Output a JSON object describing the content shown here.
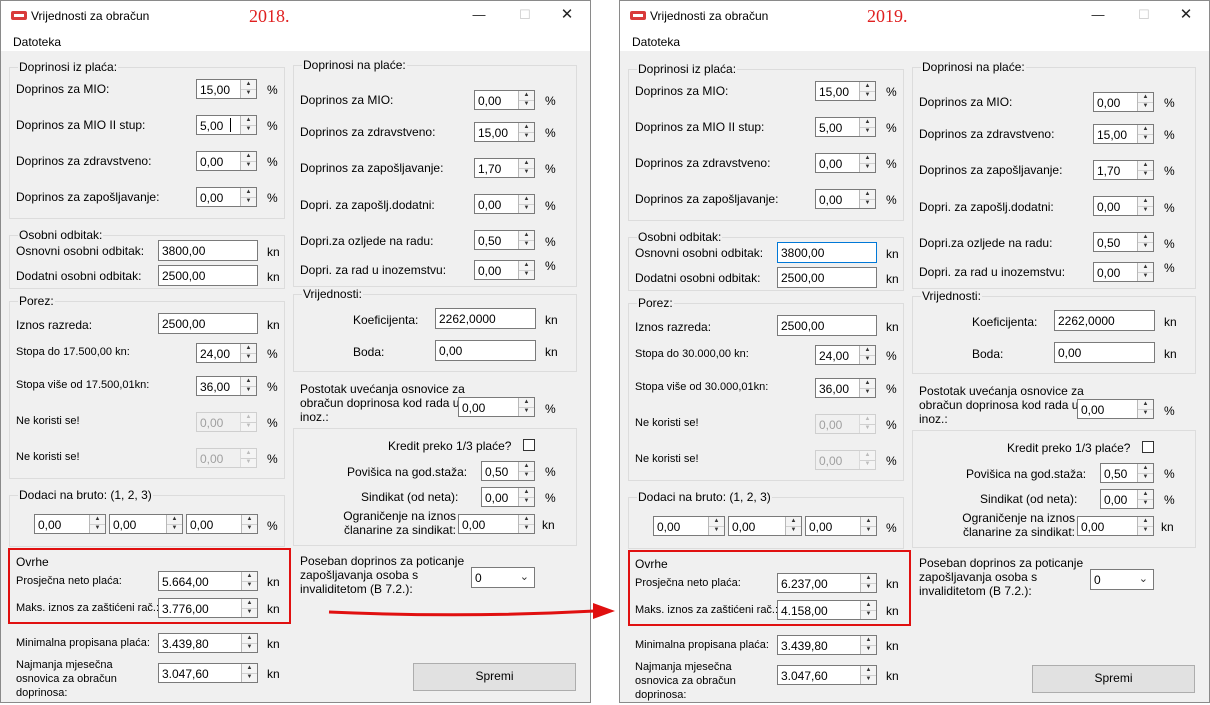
{
  "colors": {
    "annotation": "#e01010",
    "year": "#e02020",
    "focus_border": "#0078d7"
  },
  "windows": [
    {
      "id": "2018",
      "title": "Vrijednosti za obračun",
      "year_label": "2018.",
      "menu": {
        "file": "Datoteka"
      },
      "contrib_from": {
        "title": "Doprinosi iz plaća:",
        "mio_label": "Doprinos za MIO:",
        "mio": "15,00",
        "mio2_label": "Doprinos za MIO II stup:",
        "mio2": "5,00",
        "health_label": "Doprinos za zdravstveno:",
        "health": "0,00",
        "employ_label": "Doprinos za zapošljavanje:",
        "employ": "0,00"
      },
      "personal": {
        "title": "Osobni odbitak:",
        "basic_label": "Osnovni osobni odbitak:",
        "basic": "3800,00",
        "extra_label": "Dodatni osobni odbitak:",
        "extra": "2500,00"
      },
      "tax": {
        "title": "Porez:",
        "bracket_label": "Iznos razreda:",
        "bracket": "2500,00",
        "rate_low_label": "Stopa do 17.500,00 kn:",
        "rate_low": "24,00",
        "rate_high_label": "Stopa više od 17.500,01kn:",
        "rate_high": "36,00",
        "unused1_label": "Ne koristi se!",
        "unused1": "0,00",
        "unused2_label": "Ne koristi se!",
        "unused2": "0,00"
      },
      "gross": {
        "title": "Dodaci na bruto: (1, 2, 3)",
        "v1": "0,00",
        "v2": "0,00",
        "v3": "0,00"
      },
      "garnish": {
        "title": "Ovrhe",
        "avg_label": "Prosječna neto plaća:",
        "avg": "5.664,00",
        "max_label": "Maks. iznos za zaštićeni rač.:",
        "max": "3.776,00"
      },
      "min_wage": {
        "label": "Minimalna propisana plaća:",
        "value": "3.439,80"
      },
      "min_base": {
        "label": "Najmanja mjesečna osnovica za obračun doprinosa:",
        "value": "3.047,60"
      },
      "contrib_on": {
        "title": "Doprinosi na plaće:",
        "mio_label": "Doprinos za MIO:",
        "mio": "0,00",
        "health_label": "Doprinos za zdravstveno:",
        "health": "15,00",
        "employ_label": "Doprinos za zapošljavanje:",
        "employ": "1,70",
        "employ_extra_label": "Dopri. za zapošlj.dodatni:",
        "employ_extra": "0,00",
        "injury_label": "Dopri.za ozljede na radu:",
        "injury": "0,50",
        "abroad_label": "Dopri. za rad u inozemstvu:",
        "abroad": "0,00"
      },
      "values": {
        "title": "Vrijednosti:",
        "coef_label": "Koeficijenta:",
        "coef": "2262,0000",
        "points_label": "Boda:",
        "points": "0,00"
      },
      "increase": {
        "label": "Postotak uvećanja osnovice za obračun doprinosa kod rada u inoz.:",
        "value": "0,00"
      },
      "credit": {
        "label": "Kredit preko 1/3 plaće?",
        "raise_label": "Povišica na god.staža:",
        "raise": "0,50",
        "union_label": "Sindikat (od neta):",
        "union": "0,00",
        "limit_label": "Ograničenje na iznos članarine za sindikat:",
        "limit": "0,00"
      },
      "special": {
        "label": "Poseban doprinos za poticanje zapošljavanja osoba s invaliditetom (B 7.2.):",
        "value": "0"
      },
      "units": {
        "pct": "%",
        "kn": "kn"
      },
      "save_label": "Spremi"
    },
    {
      "id": "2019",
      "title": "Vrijednosti za obračun",
      "year_label": "2019.",
      "menu": {
        "file": "Datoteka"
      },
      "contrib_from": {
        "title": "Doprinosi iz plaća:",
        "mio_label": "Doprinos za MIO:",
        "mio": "15,00",
        "mio2_label": "Doprinos za MIO II stup:",
        "mio2": "5,00",
        "health_label": "Doprinos za zdravstveno:",
        "health": "0,00",
        "employ_label": "Doprinos za zapošljavanje:",
        "employ": "0,00"
      },
      "personal": {
        "title": "Osobni odbitak:",
        "basic_label": "Osnovni osobni odbitak:",
        "basic": "3800,00",
        "extra_label": "Dodatni osobni odbitak:",
        "extra": "2500,00"
      },
      "tax": {
        "title": "Porez:",
        "bracket_label": "Iznos razreda:",
        "bracket": "2500,00",
        "rate_low_label": "Stopa do 30.000,00 kn:",
        "rate_low": "24,00",
        "rate_high_label": "Stopa više od 30.000,01kn:",
        "rate_high": "36,00",
        "unused1_label": "Ne koristi se!",
        "unused1": "0,00",
        "unused2_label": "Ne koristi se!",
        "unused2": "0,00"
      },
      "gross": {
        "title": "Dodaci na bruto: (1, 2, 3)",
        "v1": "0,00",
        "v2": "0,00",
        "v3": "0,00"
      },
      "garnish": {
        "title": "Ovrhe",
        "avg_label": "Prosječna neto plaća:",
        "avg": "6.237,00",
        "max_label": "Maks. iznos za zaštićeni rač.:",
        "max": "4.158,00"
      },
      "min_wage": {
        "label": "Minimalna propisana plaća:",
        "value": "3.439,80"
      },
      "min_base": {
        "label": "Najmanja mjesečna osnovica za obračun doprinosa:",
        "value": "3.047,60"
      },
      "contrib_on": {
        "title": "Doprinosi na plaće:",
        "mio_label": "Doprinos za MIO:",
        "mio": "0,00",
        "health_label": "Doprinos za zdravstveno:",
        "health": "15,00",
        "employ_label": "Doprinos za zapošljavanje:",
        "employ": "1,70",
        "employ_extra_label": "Dopri. za zapošlj.dodatni:",
        "employ_extra": "0,00",
        "injury_label": "Dopri.za ozljede na radu:",
        "injury": "0,50",
        "abroad_label": "Dopri. za rad u inozemstvu:",
        "abroad": "0,00"
      },
      "values": {
        "title": "Vrijednosti:",
        "coef_label": "Koeficijenta:",
        "coef": "2262,0000",
        "points_label": "Boda:",
        "points": "0,00"
      },
      "increase": {
        "label": "Postotak uvećanja osnovice za obračun doprinosa kod rada u inoz.:",
        "value": "0,00"
      },
      "credit": {
        "label": "Kredit preko 1/3 plaće?",
        "raise_label": "Povišica na god.staža:",
        "raise": "0,50",
        "union_label": "Sindikat (od neta):",
        "union": "0,00",
        "limit_label": "Ograničenje na iznos članarine za sindikat:",
        "limit": "0,00"
      },
      "special": {
        "label": "Poseban doprinos za poticanje zapošljavanja osoba s invaliditetom (B 7.2.):",
        "value": "0"
      },
      "units": {
        "pct": "%",
        "kn": "kn"
      },
      "save_label": "Spremi"
    }
  ]
}
